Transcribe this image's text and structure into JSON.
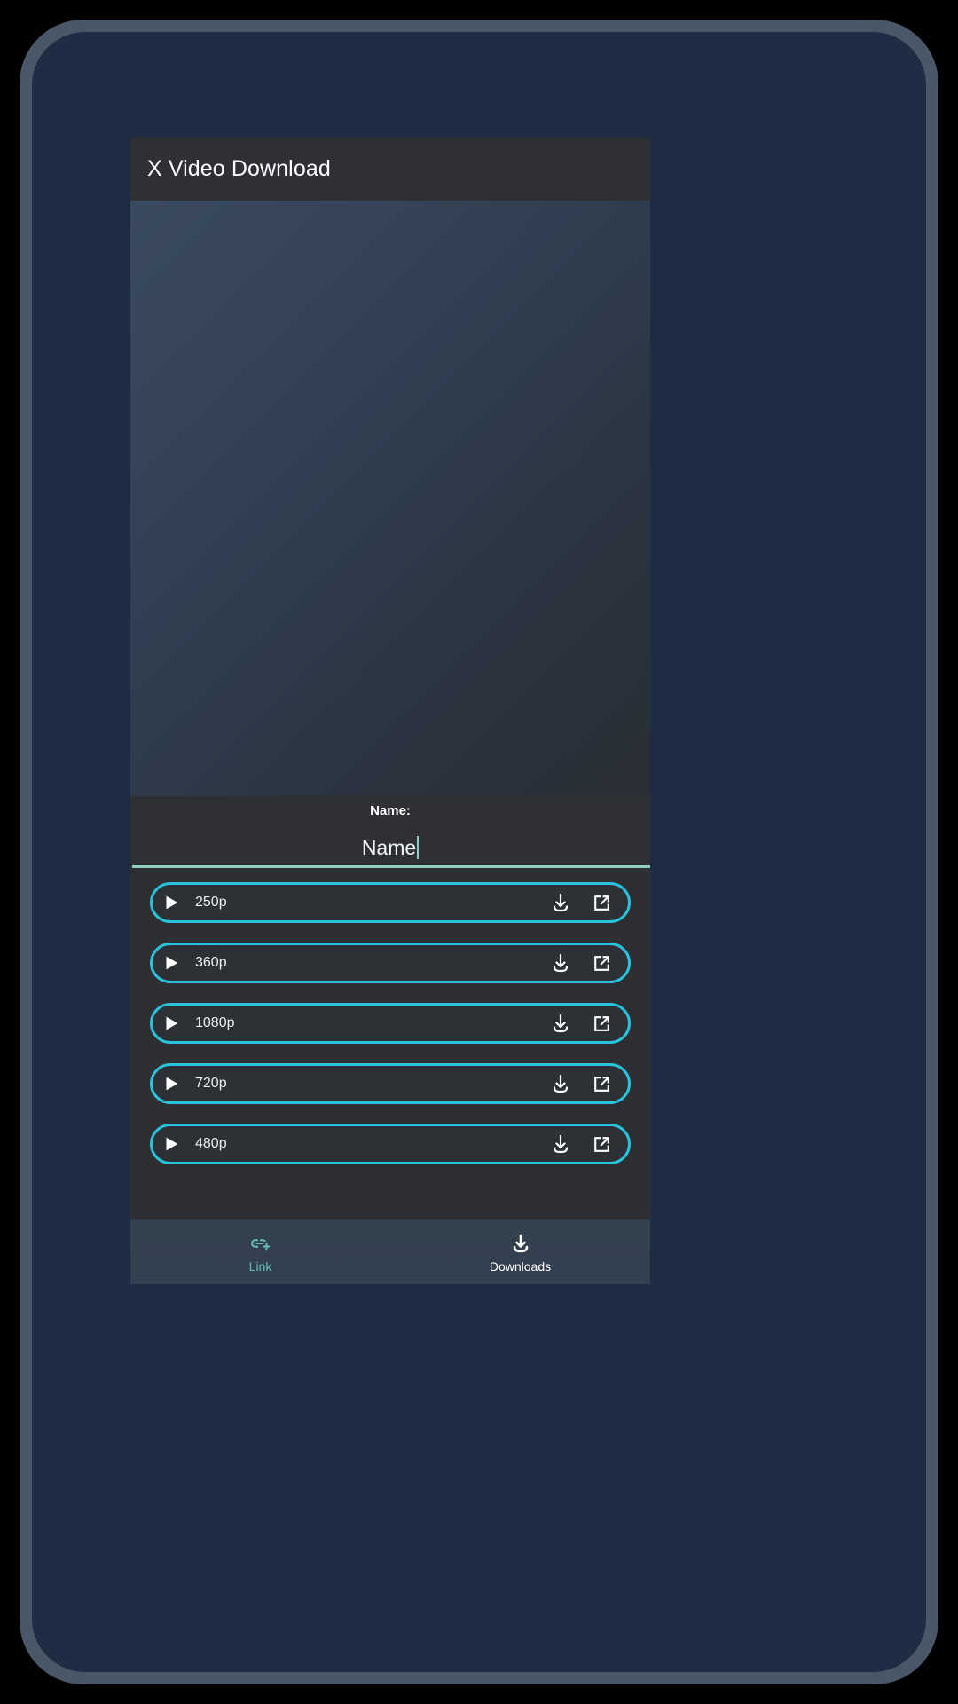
{
  "app": {
    "title": "X Video Download",
    "accent_cyan": "#29c3e0",
    "accent_teal": "#66bfb4",
    "appbar_bg": "#2f3034",
    "surface_bg": "#2d2f33",
    "screen_bg": "#1e2d44",
    "bezel": "#4a5768"
  },
  "video": {
    "icon": "video-preview-area"
  },
  "name_field": {
    "label": "Name:",
    "value": "Name",
    "placeholder": "Name",
    "caret_visible": true,
    "underline_color": "#8fcfc1"
  },
  "qualities": [
    {
      "label": "250p",
      "play_icon": "play-icon",
      "download_icon": "download-icon",
      "open_icon": "open-in-new-icon"
    },
    {
      "label": "360p",
      "play_icon": "play-icon",
      "download_icon": "download-icon",
      "open_icon": "open-in-new-icon"
    },
    {
      "label": "1080p",
      "play_icon": "play-icon",
      "download_icon": "download-icon",
      "open_icon": "open-in-new-icon"
    },
    {
      "label": "720p",
      "play_icon": "play-icon",
      "download_icon": "download-icon",
      "open_icon": "open-in-new-icon"
    },
    {
      "label": "480p",
      "play_icon": "play-icon",
      "download_icon": "download-icon",
      "open_icon": "open-in-new-icon"
    }
  ],
  "bottom_nav": [
    {
      "label": "Link",
      "icon": "add-link-icon",
      "selected": true
    },
    {
      "label": "Downloads",
      "icon": "download-icon",
      "selected": false
    }
  ]
}
